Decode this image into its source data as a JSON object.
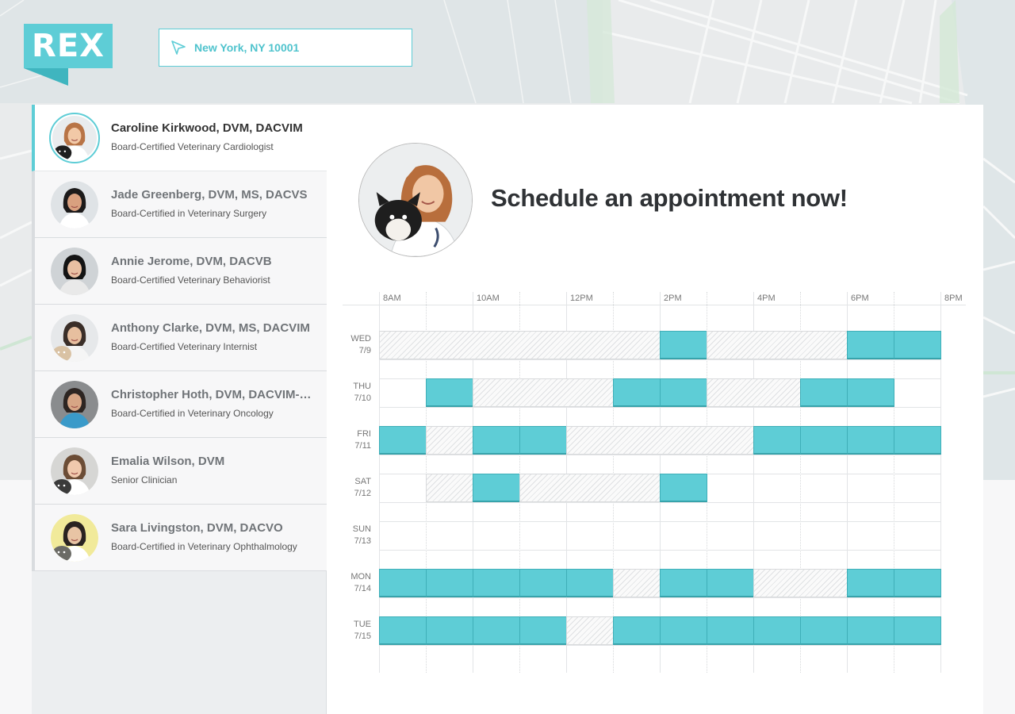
{
  "brand": {
    "logo_text": "REX"
  },
  "location": {
    "value": "New York, NY 10001",
    "icon": "location-arrow-icon"
  },
  "colors": {
    "accent": "#5ecdd6",
    "accent_dark": "#3fafb8",
    "text": "#2f3235"
  },
  "doctors": [
    {
      "name": "Caroline Kirkwood, DVM, DACVIM",
      "title": "Board-Certified Veterinary Cardiologist",
      "active": true
    },
    {
      "name": "Jade Greenberg, DVM, MS, DACVS",
      "title": "Board-Certified in Veterinary Surgery",
      "active": false
    },
    {
      "name": "Annie Jerome, DVM, DACVB",
      "title": "Board-Certified Veterinary Behaviorist",
      "active": false
    },
    {
      "name": "Anthony Clarke, DVM, MS, DACVIM",
      "title": "Board-Certified Veterinary Internist",
      "active": false
    },
    {
      "name": "Christopher Hoth, DVM, DACVIM-Onc...",
      "title": "Board-Certified in Veterinary Oncology",
      "active": false
    },
    {
      "name": "Emalia Wilson, DVM",
      "title": "Senior Clinician",
      "active": false
    },
    {
      "name": "Sara Livingston, DVM, DACVO",
      "title": "Board-Certified in Veterinary Ophthalmology",
      "active": false
    }
  ],
  "main": {
    "heading": "Schedule an appointment now!"
  },
  "schedule": {
    "time_labels": [
      "8AM",
      "10AM",
      "12PM",
      "2PM",
      "4PM",
      "6PM",
      "8PM"
    ],
    "days": [
      {
        "day": "WED",
        "date": "7/9",
        "slots": [
          {
            "start": 0,
            "end": 6,
            "status": "busy"
          },
          {
            "start": 6,
            "end": 7,
            "status": "open"
          },
          {
            "start": 7,
            "end": 10,
            "status": "busy"
          },
          {
            "start": 10,
            "end": 11,
            "status": "open"
          },
          {
            "start": 11,
            "end": 12,
            "status": "open"
          }
        ]
      },
      {
        "day": "THU",
        "date": "7/10",
        "slots": [
          {
            "start": 1,
            "end": 2,
            "status": "open"
          },
          {
            "start": 2,
            "end": 5,
            "status": "busy"
          },
          {
            "start": 5,
            "end": 6,
            "status": "open"
          },
          {
            "start": 6,
            "end": 7,
            "status": "open"
          },
          {
            "start": 7,
            "end": 9,
            "status": "busy"
          },
          {
            "start": 9,
            "end": 10,
            "status": "open"
          },
          {
            "start": 10,
            "end": 11,
            "status": "open"
          }
        ]
      },
      {
        "day": "FRI",
        "date": "7/11",
        "slots": [
          {
            "start": 0,
            "end": 1,
            "status": "open"
          },
          {
            "start": 1,
            "end": 2,
            "status": "busy"
          },
          {
            "start": 2,
            "end": 3,
            "status": "open"
          },
          {
            "start": 3,
            "end": 4,
            "status": "open"
          },
          {
            "start": 4,
            "end": 8,
            "status": "busy"
          },
          {
            "start": 8,
            "end": 9,
            "status": "open"
          },
          {
            "start": 9,
            "end": 10,
            "status": "open"
          },
          {
            "start": 10,
            "end": 11,
            "status": "open"
          },
          {
            "start": 11,
            "end": 12,
            "status": "open"
          }
        ]
      },
      {
        "day": "SAT",
        "date": "7/12",
        "slots": [
          {
            "start": 1,
            "end": 2,
            "status": "busy"
          },
          {
            "start": 2,
            "end": 3,
            "status": "open"
          },
          {
            "start": 3,
            "end": 6,
            "status": "busy"
          },
          {
            "start": 6,
            "end": 7,
            "status": "open"
          }
        ]
      },
      {
        "day": "SUN",
        "date": "7/13",
        "slots": []
      },
      {
        "day": "MON",
        "date": "7/14",
        "slots": [
          {
            "start": 0,
            "end": 1,
            "status": "open"
          },
          {
            "start": 1,
            "end": 2,
            "status": "open"
          },
          {
            "start": 2,
            "end": 3,
            "status": "open"
          },
          {
            "start": 3,
            "end": 4,
            "status": "open"
          },
          {
            "start": 4,
            "end": 5,
            "status": "open"
          },
          {
            "start": 5,
            "end": 6,
            "status": "busy"
          },
          {
            "start": 6,
            "end": 7,
            "status": "open"
          },
          {
            "start": 7,
            "end": 8,
            "status": "open"
          },
          {
            "start": 8,
            "end": 10,
            "status": "busy"
          },
          {
            "start": 10,
            "end": 11,
            "status": "open"
          },
          {
            "start": 11,
            "end": 12,
            "status": "open"
          }
        ]
      },
      {
        "day": "TUE",
        "date": "7/15",
        "slots": [
          {
            "start": 0,
            "end": 1,
            "status": "open"
          },
          {
            "start": 1,
            "end": 2,
            "status": "open"
          },
          {
            "start": 2,
            "end": 3,
            "status": "open"
          },
          {
            "start": 3,
            "end": 4,
            "status": "open"
          },
          {
            "start": 4,
            "end": 5,
            "status": "busy"
          },
          {
            "start": 5,
            "end": 6,
            "status": "open"
          },
          {
            "start": 6,
            "end": 7,
            "status": "open"
          },
          {
            "start": 7,
            "end": 8,
            "status": "open"
          },
          {
            "start": 8,
            "end": 9,
            "status": "open"
          },
          {
            "start": 9,
            "end": 10,
            "status": "open"
          },
          {
            "start": 10,
            "end": 11,
            "status": "open"
          },
          {
            "start": 11,
            "end": 12,
            "status": "open"
          }
        ]
      }
    ]
  }
}
